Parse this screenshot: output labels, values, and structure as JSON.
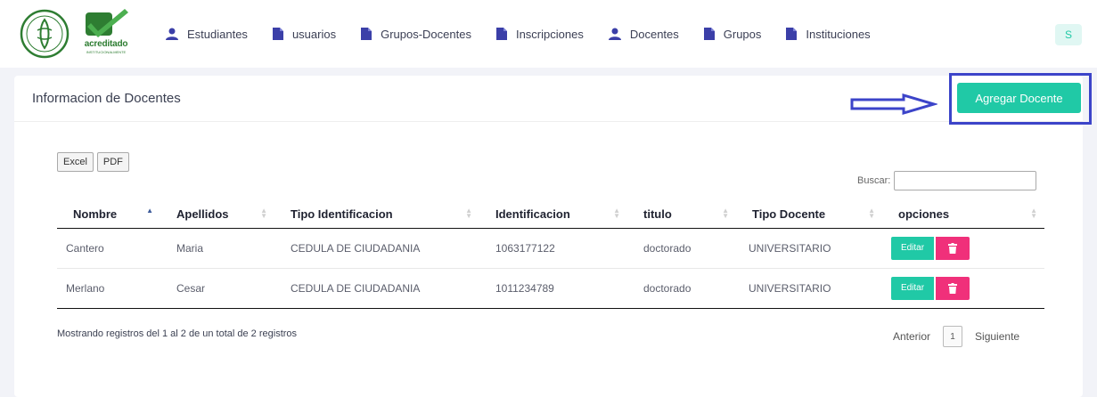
{
  "logos": {
    "accredited_text": "acreditado",
    "accredited_sub": "INSTITUCIONALMENTE"
  },
  "nav": {
    "items": [
      {
        "label": "Estudiantes",
        "icon": "user-icon"
      },
      {
        "label": "usuarios",
        "icon": "file-icon"
      },
      {
        "label": "Grupos-Docentes",
        "icon": "file-icon"
      },
      {
        "label": "Inscripciones",
        "icon": "file-icon"
      },
      {
        "label": "Docentes",
        "icon": "user-icon"
      },
      {
        "label": "Grupos",
        "icon": "file-icon"
      },
      {
        "label": "Instituciones",
        "icon": "file-icon"
      }
    ],
    "avatar_initial": "S"
  },
  "card": {
    "title": "Informacion de Docentes",
    "add_button": "Agregar Docente"
  },
  "export": {
    "excel": "Excel",
    "pdf": "PDF"
  },
  "search": {
    "label": "Buscar:",
    "value": ""
  },
  "table": {
    "columns": [
      "Nombre",
      "Apellidos",
      "Tipo Identificacion",
      "Identificacion",
      "titulo",
      "Tipo Docente",
      "opciones"
    ],
    "rows": [
      {
        "nombre": "Cantero",
        "apellidos": "Maria",
        "tipo_id": "CEDULA DE CIUDADANIA",
        "identificacion": "1063177122",
        "titulo": "doctorado",
        "tipo_docente": "UNIVERSITARIO"
      },
      {
        "nombre": "Merlano",
        "apellidos": "Cesar",
        "tipo_id": "CEDULA DE CIUDADANIA",
        "identificacion": "1011234789",
        "titulo": "doctorado",
        "tipo_docente": "UNIVERSITARIO"
      }
    ],
    "edit_label": "Editar"
  },
  "footer": {
    "info": "Mostrando registros del 1 al 2 de un total de 2 registros",
    "prev": "Anterior",
    "page": "1",
    "next": "Siguiente"
  },
  "colors": {
    "accent": "#20c9a6",
    "danger": "#f0307a",
    "highlight": "#3c44c9"
  }
}
